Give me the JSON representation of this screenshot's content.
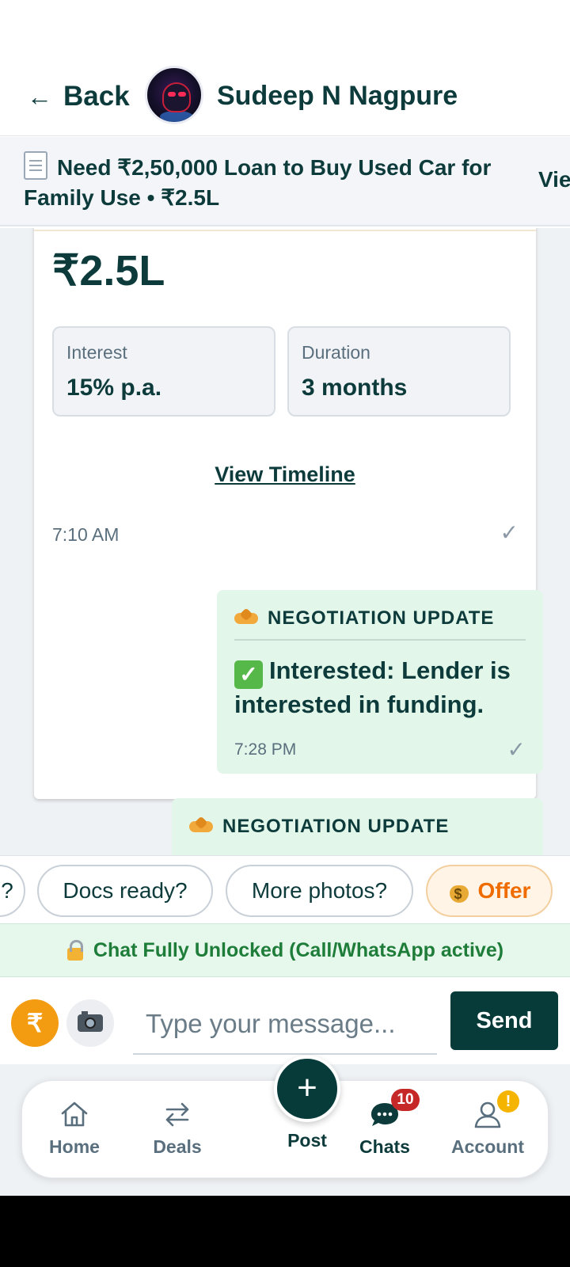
{
  "header": {
    "back_arrow": "←",
    "back_label": "Back",
    "contact_name": "Sudeep N Nagpure"
  },
  "listing": {
    "icon": "document-icon",
    "title": "Need ₹2,50,000 Loan to Buy Used Car for Family Use • ₹2.5L",
    "view_label": "Vie"
  },
  "loan_card": {
    "amount": "₹2.5L",
    "interest_label": "Interest",
    "interest_value": "15% p.a.",
    "duration_label": "Duration",
    "duration_value": "3 months",
    "timeline_link": "View Timeline",
    "time": "7:10 AM",
    "check": "✓"
  },
  "messages": [
    {
      "icon": "handshake-icon",
      "heading": "NEGOTIATION UPDATE",
      "status_icon": "✓",
      "body": "Interested: Lender is interested in funding.",
      "time": "7:28 PM",
      "check": "✓"
    },
    {
      "icon": "handshake-icon",
      "heading": "NEGOTIATION UPDATE"
    }
  ],
  "quick_replies": {
    "partial_chip": "?",
    "chips": [
      "Docs ready?",
      "More photos?"
    ],
    "offer_label": "Offer"
  },
  "unlock_banner": "Chat Fully Unlocked (Call/WhatsApp active)",
  "composer": {
    "rupee_symbol": "₹",
    "placeholder": "Type your message...",
    "send_label": "Send"
  },
  "nav": {
    "home": "Home",
    "deals": "Deals",
    "post": "Post",
    "post_symbol": "+",
    "chats": "Chats",
    "chats_badge": "10",
    "account": "Account",
    "account_alert": "!"
  },
  "colors": {
    "primary": "#073b3a",
    "text": "#0d3b3b",
    "accent_orange": "#f39c12",
    "unlock_green": "#1f7d3a",
    "message_bg": "#e3f6ea",
    "badge_red": "#c62828"
  }
}
